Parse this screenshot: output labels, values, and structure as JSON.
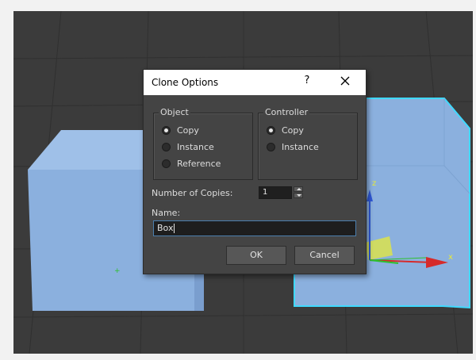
{
  "dialog": {
    "title": "Clone Options",
    "help_label": "?",
    "object_group": {
      "label": "Object",
      "options": [
        {
          "label": "Copy",
          "selected": true
        },
        {
          "label": "Instance",
          "selected": false
        },
        {
          "label": "Reference",
          "selected": false
        }
      ]
    },
    "controller_group": {
      "label": "Controller",
      "options": [
        {
          "label": "Copy",
          "selected": true
        },
        {
          "label": "Instance",
          "selected": false
        }
      ]
    },
    "copies_label": "Number of Copies:",
    "copies_value": "1",
    "name_label": "Name:",
    "name_value": "Box",
    "ok_label": "OK",
    "cancel_label": "Cancel"
  },
  "viewport": {
    "axis_labels": {
      "z": "z",
      "x": "x"
    },
    "colors": {
      "box_fill": "#8bb0de",
      "selection_outline": "#3fd9ff",
      "axis_x": "#d62a2a",
      "axis_y": "#2ec02e",
      "axis_z": "#2f58d6",
      "gizmo_plane": "#e5e93a",
      "grid": "#2f2f2f",
      "background": "#3b3b3b"
    }
  }
}
